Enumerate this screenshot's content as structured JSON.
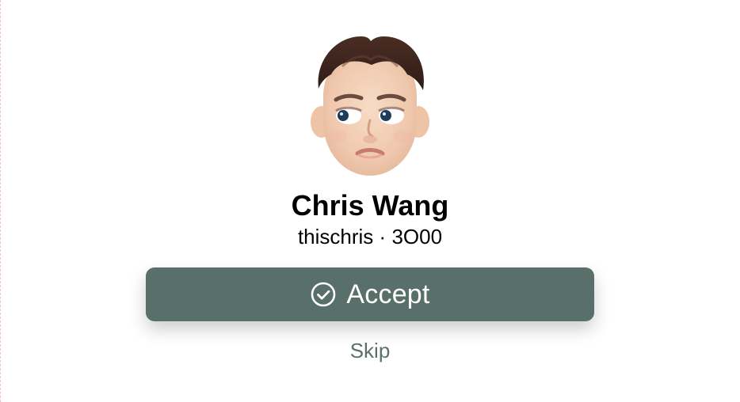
{
  "colors": {
    "accent": "#586f6a",
    "skip_text": "#5a706b",
    "background": "#ffffff"
  },
  "profile": {
    "name": "Chris Wang",
    "username": "thischris",
    "separator": "·",
    "id": "3O00",
    "avatar_icon": "memoji-avatar-icon"
  },
  "actions": {
    "accept_label": "Accept",
    "accept_icon": "check-circle-icon",
    "skip_label": "Skip"
  }
}
